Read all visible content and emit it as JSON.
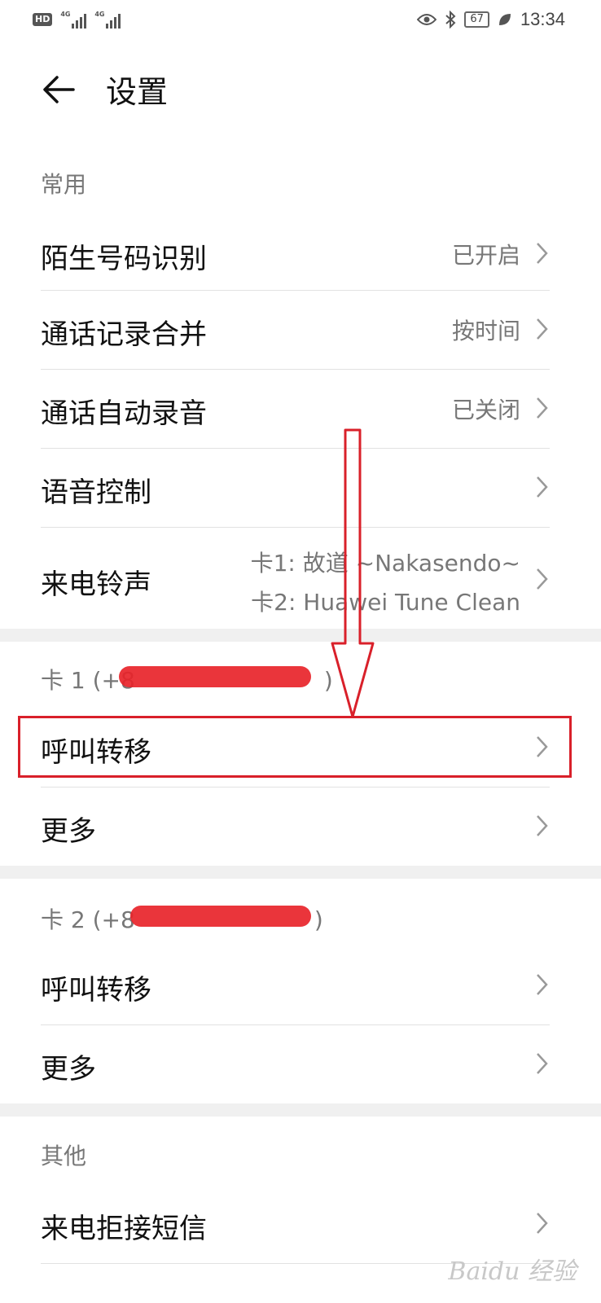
{
  "status_bar": {
    "hd_badge": "HD",
    "network_1": "4G",
    "network_2": "4G",
    "battery": "67",
    "time": "13:34"
  },
  "header": {
    "title": "设置",
    "back_icon": "arrow-left-icon"
  },
  "sections": {
    "common": {
      "label": "常用",
      "items": [
        {
          "label": "陌生号码识别",
          "value": "已开启"
        },
        {
          "label": "通话记录合并",
          "value": "按时间"
        },
        {
          "label": "通话自动录音",
          "value": "已关闭"
        },
        {
          "label": "语音控制",
          "value": ""
        },
        {
          "label": "来电铃声",
          "value_line1": "卡1: 故道 ~Nakasendo~",
          "value_line2": "卡2: Huawei Tune Clean"
        }
      ]
    },
    "card1": {
      "label_prefix": "卡 1 (+8",
      "label_suffix": ")",
      "items": [
        {
          "label": "呼叫转移"
        },
        {
          "label": "更多"
        }
      ]
    },
    "card2": {
      "label_prefix": "卡 2 (+8",
      "label_suffix": ")",
      "items": [
        {
          "label": "呼叫转移"
        },
        {
          "label": "更多"
        }
      ]
    },
    "other": {
      "label": "其他",
      "items": [
        {
          "label": "来电拒接短信"
        }
      ]
    }
  },
  "annotation": {
    "highlight_color": "#d9202a"
  },
  "watermark": "Baidu 经验"
}
